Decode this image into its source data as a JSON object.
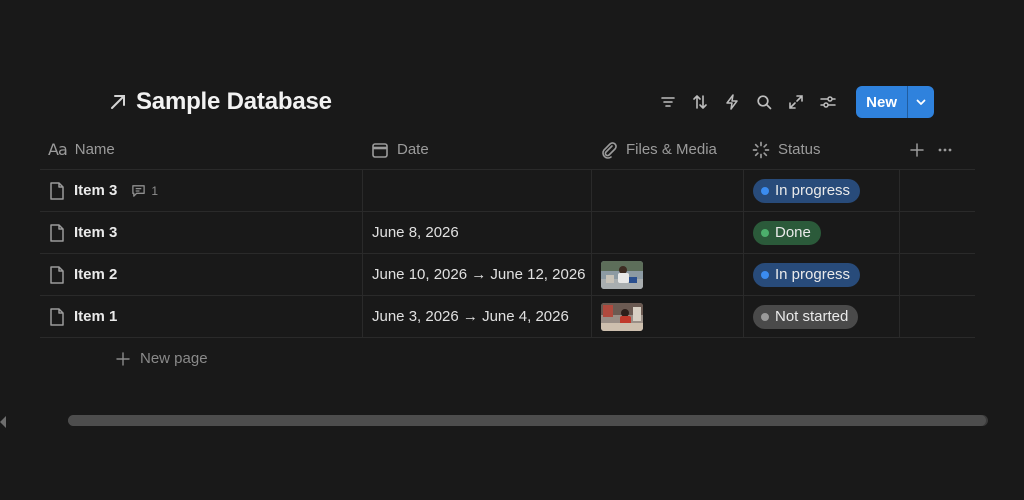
{
  "header": {
    "title": "Sample Database",
    "title_icon": "arrow-up-right-icon",
    "toolbar": [
      "filter-icon",
      "sort-icon",
      "automation-icon",
      "search-icon",
      "expand-icon",
      "settings-icon"
    ],
    "new_label": "New"
  },
  "columns": {
    "name": "Name",
    "date": "Date",
    "files": "Files & Media",
    "status": "Status"
  },
  "rows": [
    {
      "name": "Item 3",
      "comments": "1",
      "date": "",
      "files": "",
      "status": "In progress"
    },
    {
      "name": "Item 3",
      "comments": "",
      "date": "June 8, 2026",
      "files": "",
      "status": "Done"
    },
    {
      "name": "Item 2",
      "comments": "",
      "date": "June 10, 2026 → June 12, 2026",
      "files": "image",
      "status": "In progress"
    },
    {
      "name": "Item 1",
      "comments": "",
      "date": "June 3, 2026 → June 4, 2026",
      "files": "image",
      "status": "Not started"
    }
  ],
  "status_colors": {
    "in_progress_bg": "#284b7a",
    "in_progress_dot": "#3b8cf0",
    "done_bg": "#2b5a3a",
    "done_dot": "#4caf6c",
    "not_started_bg": "#4a4a4a",
    "not_started_dot": "#9a9a9a"
  },
  "footer": {
    "new_page": "New page"
  },
  "accent": "#2f82dd"
}
